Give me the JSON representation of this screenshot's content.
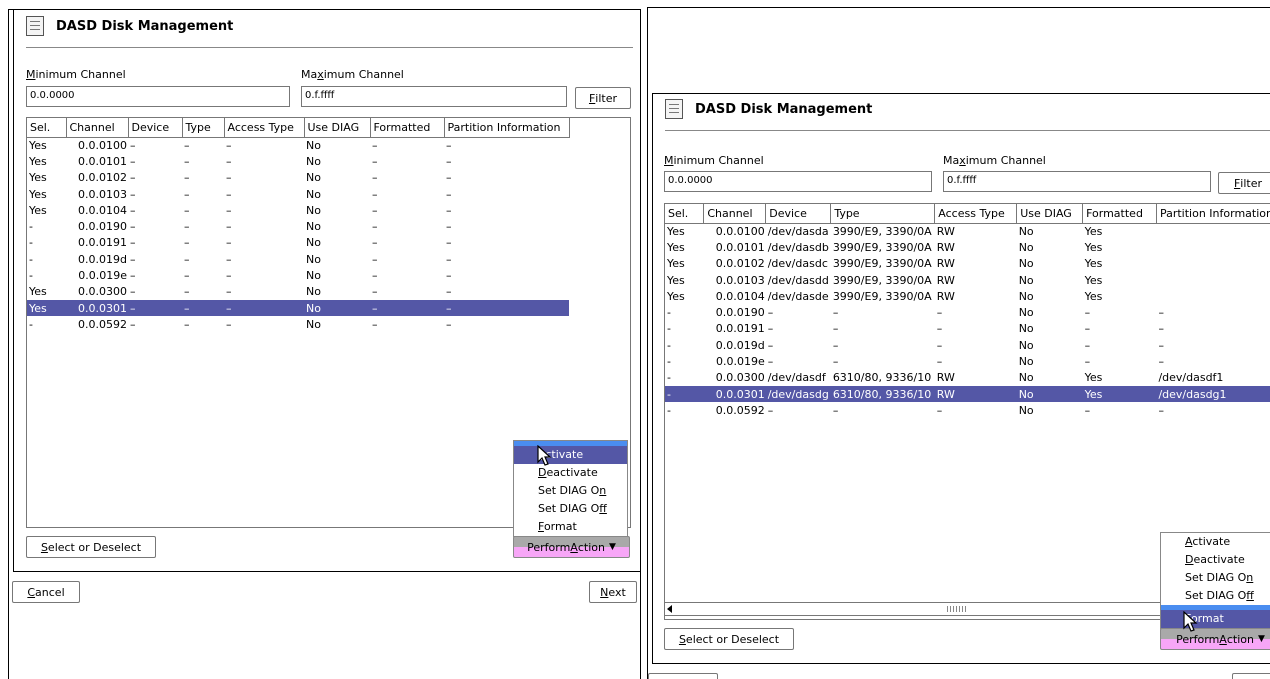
{
  "windows": [
    {
      "title": "DASD Disk Management",
      "min_channel": {
        "label_pre": "",
        "label_u": "M",
        "label_post": "inimum Channel",
        "value": "0.0.0000"
      },
      "max_channel": {
        "label_pre": "Ma",
        "label_u": "x",
        "label_post": "imum Channel",
        "value": "0.f.ffff"
      },
      "filter": {
        "u": "F",
        "rest": "ilter"
      },
      "columns": [
        "Sel.",
        "Channel",
        "Device",
        "Type",
        "Access Type",
        "Use DIAG",
        "Formatted",
        "Partition Information"
      ],
      "rows": [
        [
          "Yes",
          "0.0.0100",
          "–",
          "–",
          "–",
          "No",
          "–",
          "–"
        ],
        [
          "Yes",
          "0.0.0101",
          "–",
          "–",
          "–",
          "No",
          "–",
          "–"
        ],
        [
          "Yes",
          "0.0.0102",
          "–",
          "–",
          "–",
          "No",
          "–",
          "–"
        ],
        [
          "Yes",
          "0.0.0103",
          "–",
          "–",
          "–",
          "No",
          "–",
          "–"
        ],
        [
          "Yes",
          "0.0.0104",
          "–",
          "–",
          "–",
          "No",
          "–",
          "–"
        ],
        [
          "-",
          "0.0.0190",
          "–",
          "–",
          "–",
          "No",
          "–",
          "–"
        ],
        [
          "-",
          "0.0.0191",
          "–",
          "–",
          "–",
          "No",
          "–",
          "–"
        ],
        [
          "-",
          "0.0.019d",
          "–",
          "–",
          "–",
          "No",
          "–",
          "–"
        ],
        [
          "-",
          "0.0.019e",
          "–",
          "–",
          "–",
          "No",
          "–",
          "–"
        ],
        [
          "Yes",
          "0.0.0300",
          "–",
          "–",
          "–",
          "No",
          "–",
          "–"
        ],
        [
          "Yes",
          "0.0.0301",
          "–",
          "–",
          "–",
          "No",
          "–",
          "–"
        ],
        [
          "-",
          "0.0.0592",
          "–",
          "–",
          "–",
          "No",
          "–",
          "–"
        ]
      ],
      "selected_row": 10,
      "select_or_deselect": {
        "u": "S",
        "rest": "elect or Deselect"
      },
      "perform_action": {
        "pre": "Perform ",
        "u": "A",
        "post": "ction"
      },
      "menu": [
        {
          "pre": "",
          "u": "A",
          "post": "ctivate"
        },
        {
          "pre": "",
          "u": "D",
          "post": "eactivate"
        },
        {
          "pre": "Set DIAG O",
          "u": "n",
          "post": ""
        },
        {
          "pre": "Set DIAG O",
          "u": "f",
          "post": "f"
        },
        {
          "pre": "",
          "u": "F",
          "post": "ormat"
        }
      ],
      "highlighted_menu_item": 0,
      "cancel": {
        "u": "C",
        "rest": "ancel"
      },
      "next": {
        "u": "N",
        "rest": "ext"
      }
    },
    {
      "title": "DASD Disk Management",
      "min_channel": {
        "label_pre": "",
        "label_u": "M",
        "label_post": "inimum Channel",
        "value": "0.0.0000"
      },
      "max_channel": {
        "label_pre": "Ma",
        "label_u": "x",
        "label_post": "imum Channel",
        "value": "0.f.ffff"
      },
      "filter": {
        "u": "F",
        "rest": "ilter"
      },
      "columns": [
        "Sel.",
        "Channel",
        "Device",
        "Type",
        "Access Type",
        "Use DIAG",
        "Formatted",
        "Partition Information"
      ],
      "rows": [
        [
          "Yes",
          "0.0.0100",
          "/dev/dasda",
          "3990/E9, 3390/0A",
          "RW",
          "No",
          "Yes",
          ""
        ],
        [
          "Yes",
          "0.0.0101",
          "/dev/dasdb",
          "3990/E9, 3390/0A",
          "RW",
          "No",
          "Yes",
          ""
        ],
        [
          "Yes",
          "0.0.0102",
          "/dev/dasdc",
          "3990/E9, 3390/0A",
          "RW",
          "No",
          "Yes",
          ""
        ],
        [
          "Yes",
          "0.0.0103",
          "/dev/dasdd",
          "3990/E9, 3390/0A",
          "RW",
          "No",
          "Yes",
          ""
        ],
        [
          "Yes",
          "0.0.0104",
          "/dev/dasde",
          "3990/E9, 3390/0A",
          "RW",
          "No",
          "Yes",
          ""
        ],
        [
          "-",
          "0.0.0190",
          "–",
          "–",
          "–",
          "No",
          "–",
          "–"
        ],
        [
          "-",
          "0.0.0191",
          "–",
          "–",
          "–",
          "No",
          "–",
          "–"
        ],
        [
          "-",
          "0.0.019d",
          "–",
          "–",
          "–",
          "No",
          "–",
          "–"
        ],
        [
          "-",
          "0.0.019e",
          "–",
          "–",
          "–",
          "No",
          "–",
          "–"
        ],
        [
          "-",
          "0.0.0300",
          "/dev/dasdf",
          "6310/80, 9336/10",
          "RW",
          "No",
          "Yes",
          "/dev/dasdf1"
        ],
        [
          "-",
          "0.0.0301",
          "/dev/dasdg",
          "6310/80, 9336/10",
          "RW",
          "No",
          "Yes",
          "/dev/dasdg1"
        ],
        [
          "-",
          "0.0.0592",
          "–",
          "–",
          "–",
          "No",
          "–",
          "–"
        ]
      ],
      "selected_row": 10,
      "select_or_deselect": {
        "u": "S",
        "rest": "elect or Deselect"
      },
      "perform_action": {
        "pre": "Perform ",
        "u": "A",
        "post": "ction"
      },
      "menu": [
        {
          "pre": "",
          "u": "A",
          "post": "ctivate"
        },
        {
          "pre": "",
          "u": "D",
          "post": "eactivate"
        },
        {
          "pre": "Set DIAG O",
          "u": "n",
          "post": ""
        },
        {
          "pre": "Set DIAG O",
          "u": "f",
          "post": "f"
        },
        {
          "pre": "",
          "u": "F",
          "post": "ormat"
        }
      ],
      "highlighted_menu_item": 4
    }
  ],
  "colors": {
    "selection": "#5457a6",
    "menu_accent": "#4a8df0",
    "perform_bottom": "#f7a6f7"
  }
}
